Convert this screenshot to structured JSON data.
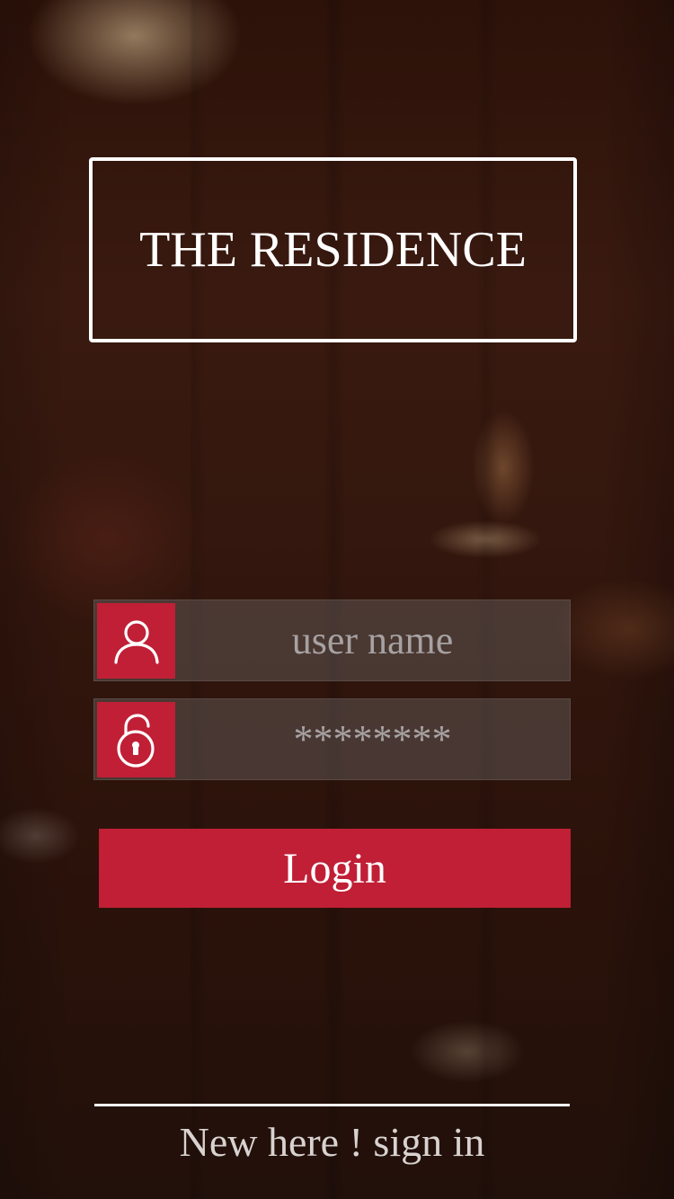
{
  "brand": {
    "title": "THE RESIDENCE"
  },
  "login_form": {
    "username": {
      "placeholder": "user name",
      "value": "",
      "icon": "user-icon"
    },
    "password": {
      "placeholder": "********",
      "value": "",
      "icon": "unlock-icon"
    },
    "login_label": "Login"
  },
  "footer": {
    "signup_text": "New here ! sign in"
  },
  "colors": {
    "accent": "#c01f36",
    "text": "#ffffff",
    "placeholder": "#a7a2a2"
  }
}
